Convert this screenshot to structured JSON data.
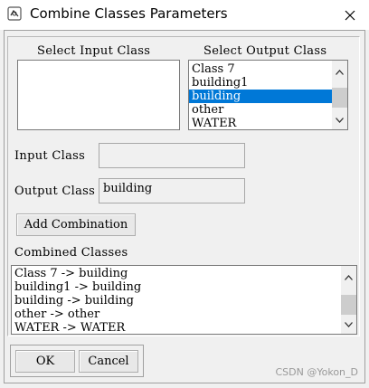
{
  "window": {
    "title": "Combine Classes Parameters",
    "icon": "app-icon",
    "close_icon": "close-icon"
  },
  "input_class_list": {
    "label": "Select Input Class",
    "items": []
  },
  "output_class_list": {
    "label": "Select Output Class",
    "items": [
      "Class 7",
      "building1",
      "building",
      "other",
      "WATER"
    ],
    "selected": "building"
  },
  "input_class_field": {
    "label": "Input Class",
    "value": ""
  },
  "output_class_field": {
    "label": "Output Class",
    "value": "building"
  },
  "add_combination_button": {
    "label": "Add Combination"
  },
  "combined_classes": {
    "label": "Combined Classes",
    "items": [
      "Class 7 -> building",
      "building1 -> building",
      "building -> building",
      "other -> other",
      "WATER -> WATER"
    ]
  },
  "buttons": {
    "ok": "OK",
    "cancel": "Cancel"
  },
  "watermark": "CSDN @Yokon_D",
  "colors": {
    "selection": "#0078d7",
    "background": "#f0f0f0"
  }
}
